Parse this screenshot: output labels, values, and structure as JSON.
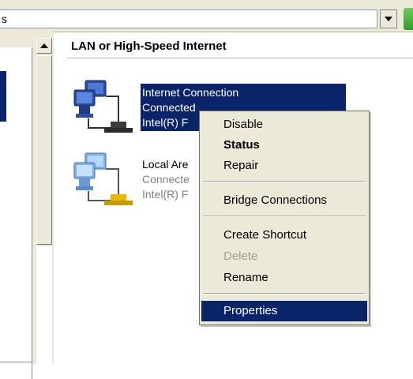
{
  "address_bar": {
    "value": "s"
  },
  "group_header": "LAN or High-Speed Internet",
  "connections": [
    {
      "name": "Internet Connection",
      "status": "Connected",
      "device": "Intel(R) F"
    },
    {
      "name": "Local Are",
      "status": "Connecte",
      "device": "Intel(R) F"
    }
  ],
  "context_menu": {
    "items": [
      {
        "label": "Disable"
      },
      {
        "label": "Status"
      },
      {
        "label": "Repair"
      },
      {
        "label": "Bridge Connections"
      },
      {
        "label": "Create Shortcut"
      },
      {
        "label": "Delete"
      },
      {
        "label": "Rename"
      },
      {
        "label": "Properties"
      }
    ]
  },
  "icons": {
    "address_dropdown": "chevron-down-icon",
    "scroll_up": "scroll-up-arrow-icon",
    "connection_icon": "network-connection-icon"
  },
  "colors": {
    "selection": "#0a246a",
    "menu_background": "#ece9d8",
    "window_background": "#ffffff",
    "disabled_text": "#a19f95"
  }
}
